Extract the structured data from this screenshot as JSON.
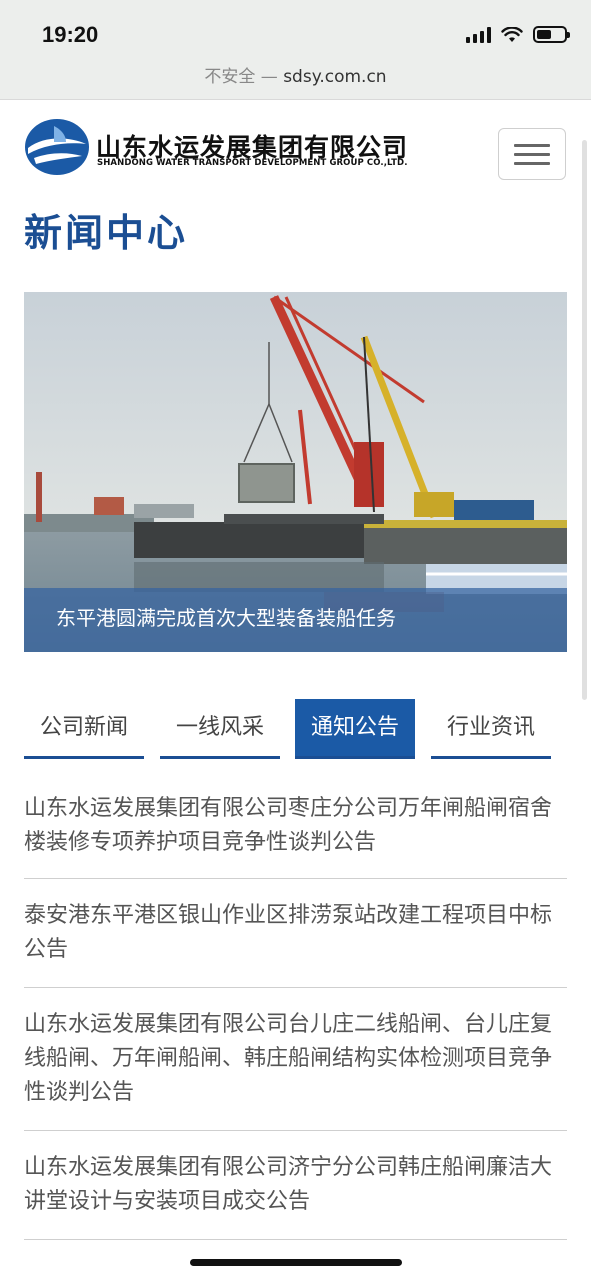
{
  "status_bar": {
    "time": "19:20",
    "icons": [
      "signal-icon",
      "wifi-icon",
      "battery-icon"
    ],
    "battery_level": 0.55
  },
  "url_bar": {
    "insecure_label": "不安全 —",
    "domain": "sdsy.com.cn"
  },
  "header": {
    "logo_cn": "山东水运发展集团有限公司",
    "logo_en": "SHANDONG WATER TRANSPORT DEVELOPMENT GROUP CO.,LTD.",
    "menu_icon": "hamburger-menu-icon"
  },
  "page_title": "新闻中心",
  "hero": {
    "caption": "东平港圆满完成首次大型装备装船任务"
  },
  "tabs": [
    {
      "label": "公司新闻",
      "active": false
    },
    {
      "label": "一线风采",
      "active": false
    },
    {
      "label": "通知公告",
      "active": true
    },
    {
      "label": "行业资讯",
      "active": false
    }
  ],
  "news": [
    {
      "title": "山东水运发展集团有限公司枣庄分公司万年闸船闸宿舍楼装修专项养护项目竞争性谈判公告"
    },
    {
      "title": "泰安港东平港区银山作业区排涝泵站改建工程项目中标公告"
    },
    {
      "title": "山东水运发展集团有限公司台儿庄二线船闸、台儿庄复线船闸、万年闸船闸、韩庄船闸结构实体检测项目竞争性谈判公告"
    },
    {
      "title": "山东水运发展集团有限公司济宁分公司韩庄船闸廉洁大讲堂设计与安装项目成交公告"
    }
  ],
  "colors": {
    "brand_blue": "#1b4e93",
    "active_tab": "#1b5aa6"
  }
}
